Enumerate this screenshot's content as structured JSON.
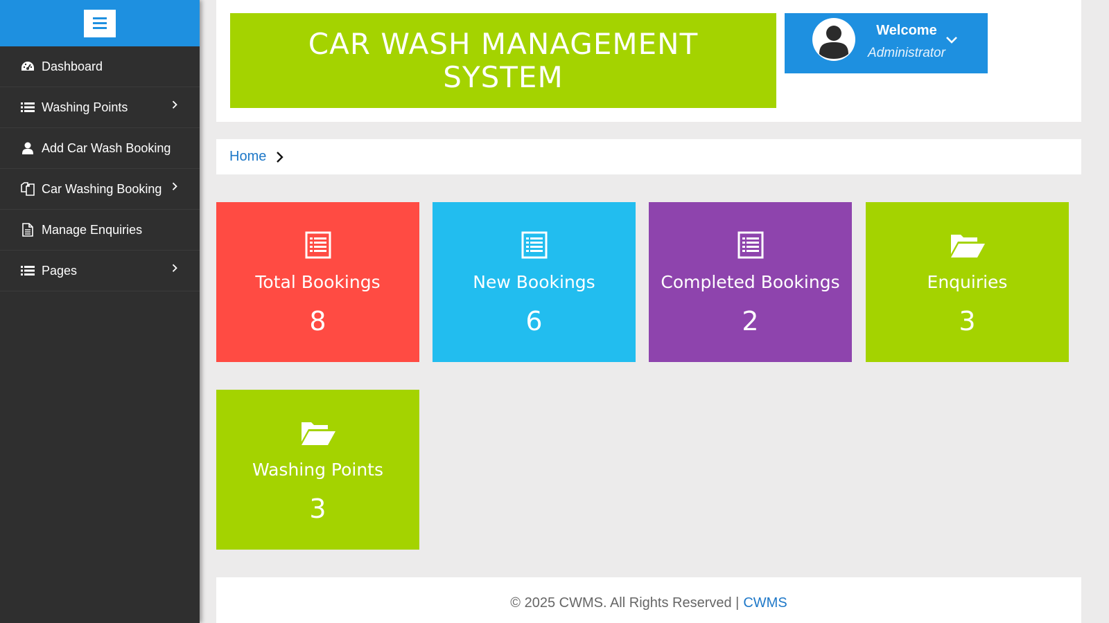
{
  "header": {
    "title": "CAR WASH MANAGEMENT SYSTEM",
    "welcome": "Welcome",
    "role": "Administrator"
  },
  "sidebar": {
    "items": [
      {
        "label": "Dashboard",
        "icon": "dashboard-icon",
        "has_submenu": false
      },
      {
        "label": "Washing Points",
        "icon": "list-icon",
        "has_submenu": true
      },
      {
        "label": "Add Car Wash Booking",
        "icon": "user-icon",
        "has_submenu": false
      },
      {
        "label": "Car Washing Booking",
        "icon": "copy-icon",
        "has_submenu": true
      },
      {
        "label": "Manage Enquiries",
        "icon": "document-icon",
        "has_submenu": false
      },
      {
        "label": "Pages",
        "icon": "list-icon",
        "has_submenu": true
      }
    ]
  },
  "breadcrumb": {
    "home": "Home"
  },
  "cards": [
    {
      "label": "Total Bookings",
      "value": "8",
      "color": "#ff4b43",
      "icon": "list-alt-icon"
    },
    {
      "label": "New Bookings",
      "value": "6",
      "color": "#22bdef",
      "icon": "list-alt-icon"
    },
    {
      "label": "Completed Bookings",
      "value": "2",
      "color": "#8e44ad",
      "icon": "list-alt-icon"
    },
    {
      "label": "Enquiries",
      "value": "3",
      "color": "#a4d300",
      "icon": "folder-open-icon"
    },
    {
      "label": "Washing Points",
      "value": "3",
      "color": "#a4d300",
      "icon": "folder-open-icon"
    }
  ],
  "footer": {
    "copyright": "© 2025 CWMS. All Rights Reserved |",
    "link": "CWMS"
  },
  "colors": {
    "sidebar_bg": "#2f2f2f",
    "accent_blue": "#1e90e0",
    "lime": "#a4d300",
    "page_bg": "#ecebeb"
  }
}
